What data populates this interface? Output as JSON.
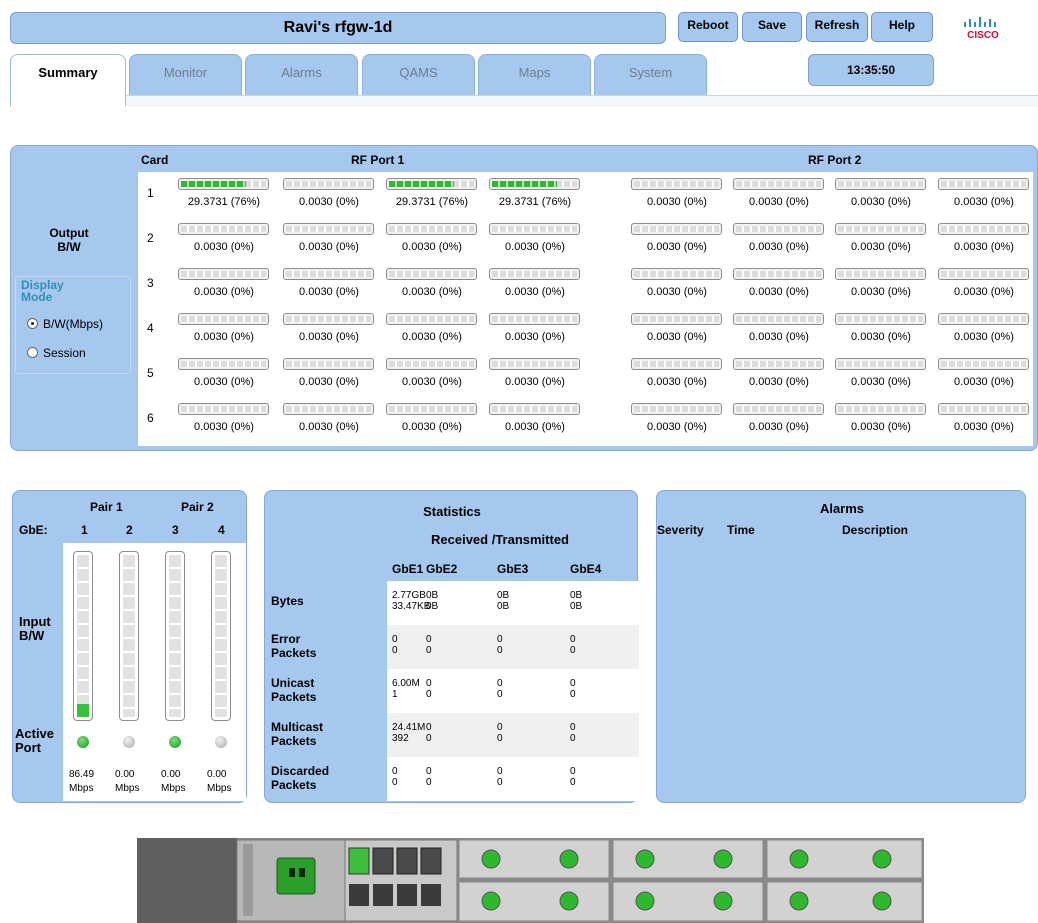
{
  "header": {
    "device_title": "Ravi's rfgw-1d",
    "buttons": [
      "Reboot",
      "Save",
      "Refresh",
      "Help"
    ],
    "clock": "13:35:50",
    "logo_text": "CISCO"
  },
  "tabs": [
    {
      "label": "Summary",
      "active": true
    },
    {
      "label": "Monitor",
      "active": false
    },
    {
      "label": "Alarms",
      "active": false
    },
    {
      "label": "QAMS",
      "active": false
    },
    {
      "label": "Maps",
      "active": false
    },
    {
      "label": "System",
      "active": false
    }
  ],
  "output_panel": {
    "output_label_line1": "Output",
    "output_label_line2": "B/W",
    "display_mode_line1": "Display",
    "display_mode_line2": "Mode",
    "mode_options": [
      {
        "label": "B/W(Mbps)",
        "selected": true
      },
      {
        "label": "Session",
        "selected": false
      }
    ],
    "card_header": "Card",
    "rf_port1_header": "RF Port 1",
    "rf_port2_header": "RF Port 2",
    "cards": [
      {
        "num": "1",
        "values": [
          "29.3731 (76%)",
          "0.0030 (0%)",
          "29.3731 (76%)",
          "29.3731 (76%)",
          "0.0030 (0%)",
          "0.0030 (0%)",
          "0.0030 (0%)",
          "0.0030 (0%)"
        ],
        "fills": [
          0.76,
          0,
          0.76,
          0.76,
          0,
          0,
          0,
          0
        ]
      },
      {
        "num": "2",
        "values": [
          "0.0030 (0%)",
          "0.0030 (0%)",
          "0.0030 (0%)",
          "0.0030 (0%)",
          "0.0030 (0%)",
          "0.0030 (0%)",
          "0.0030 (0%)",
          "0.0030 (0%)"
        ],
        "fills": [
          0,
          0,
          0,
          0,
          0,
          0,
          0,
          0
        ]
      },
      {
        "num": "3",
        "values": [
          "0.0030 (0%)",
          "0.0030 (0%)",
          "0.0030 (0%)",
          "0.0030 (0%)",
          "0.0030 (0%)",
          "0.0030 (0%)",
          "0.0030 (0%)",
          "0.0030 (0%)"
        ],
        "fills": [
          0,
          0,
          0,
          0,
          0,
          0,
          0,
          0
        ]
      },
      {
        "num": "4",
        "values": [
          "0.0030 (0%)",
          "0.0030 (0%)",
          "0.0030 (0%)",
          "0.0030 (0%)",
          "0.0030 (0%)",
          "0.0030 (0%)",
          "0.0030 (0%)",
          "0.0030 (0%)"
        ],
        "fills": [
          0,
          0,
          0,
          0,
          0,
          0,
          0,
          0
        ]
      },
      {
        "num": "5",
        "values": [
          "0.0030 (0%)",
          "0.0030 (0%)",
          "0.0030 (0%)",
          "0.0030 (0%)",
          "0.0030 (0%)",
          "0.0030 (0%)",
          "0.0030 (0%)",
          "0.0030 (0%)"
        ],
        "fills": [
          0,
          0,
          0,
          0,
          0,
          0,
          0,
          0
        ]
      },
      {
        "num": "6",
        "values": [
          "0.0030 (0%)",
          "0.0030 (0%)",
          "0.0030 (0%)",
          "0.0030 (0%)",
          "0.0030 (0%)",
          "0.0030 (0%)",
          "0.0030 (0%)",
          "0.0030 (0%)"
        ],
        "fills": [
          0,
          0,
          0,
          0,
          0,
          0,
          0,
          0
        ]
      }
    ]
  },
  "input_panel": {
    "pair1": "Pair 1",
    "pair2": "Pair 2",
    "gbe_label": "GbE:",
    "ports": [
      {
        "num": "1",
        "fill": 0.08,
        "active": true,
        "rate": "86.49",
        "unit": "Mbps"
      },
      {
        "num": "2",
        "fill": 0,
        "active": false,
        "rate": "0.00",
        "unit": "Mbps"
      },
      {
        "num": "3",
        "fill": 0,
        "active": true,
        "rate": "0.00",
        "unit": "Mbps"
      },
      {
        "num": "4",
        "fill": 0,
        "active": false,
        "rate": "0.00",
        "unit": "Mbps"
      }
    ],
    "input_label_line1": "Input",
    "input_label_line2": "B/W",
    "active_label_line1": "Active",
    "active_label_line2": "Port"
  },
  "stats_panel": {
    "title": "Statistics",
    "subtitle": "Received /Transmitted",
    "columns": [
      "GbE1",
      "GbE2",
      "GbE3",
      "GbE4"
    ],
    "rows": [
      {
        "label1": "Bytes",
        "label2": "",
        "cells": [
          [
            "2.77GB",
            "33.47KB"
          ],
          [
            "0B",
            "0B"
          ],
          [
            "0B",
            "0B"
          ],
          [
            "0B",
            "0B"
          ]
        ]
      },
      {
        "label1": "Error",
        "label2": "Packets",
        "cells": [
          [
            "0",
            "0"
          ],
          [
            "0",
            "0"
          ],
          [
            "0",
            "0"
          ],
          [
            "0",
            "0"
          ]
        ]
      },
      {
        "label1": "Unicast",
        "label2": "Packets",
        "cells": [
          [
            "6.00M",
            "1"
          ],
          [
            "0",
            "0"
          ],
          [
            "0",
            "0"
          ],
          [
            "0",
            "0"
          ]
        ]
      },
      {
        "label1": "Multicast",
        "label2": "Packets",
        "cells": [
          [
            "24.41M",
            "392"
          ],
          [
            "0",
            "0"
          ],
          [
            "0",
            "0"
          ],
          [
            "0",
            "0"
          ]
        ]
      },
      {
        "label1": "Discarded",
        "label2": "Packets",
        "cells": [
          [
            "0",
            "0"
          ],
          [
            "0",
            "0"
          ],
          [
            "0",
            "0"
          ],
          [
            "0",
            "0"
          ]
        ]
      }
    ]
  },
  "alarms_panel": {
    "title": "Alarms",
    "col_severity": "Severity",
    "col_time": "Time",
    "col_description": "Description"
  },
  "colors": {
    "panel_blue": "#a6c8ee",
    "active_green": "#2bb82b"
  }
}
